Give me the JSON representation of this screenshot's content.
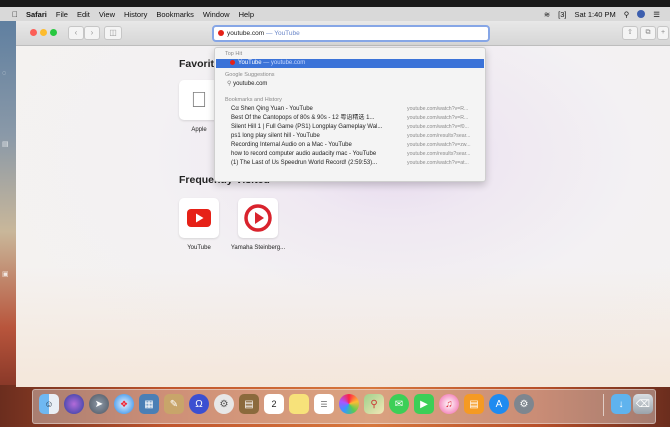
{
  "menubar": {
    "app": "Safari",
    "items": [
      "File",
      "Edit",
      "View",
      "History",
      "Bookmarks",
      "Window",
      "Help"
    ],
    "battery": "[3]",
    "clock": "Sat 1:40 PM"
  },
  "address_bar": {
    "text": "youtube.com",
    "hint": " — YouTube"
  },
  "dropdown": {
    "top_hit_header": "Top Hit",
    "top_hit": {
      "title": "YouTube",
      "url": " — youtube.com"
    },
    "google_header": "Google Suggestions",
    "google_suggestion": "youtube.com",
    "bookmarks_header": "Bookmarks and History",
    "bookmarks": [
      {
        "title": "Cα Shen Qing Yuan - YouTube",
        "url": "youtube.com/watch?v=R..."
      },
      {
        "title": "Best Of the Cantopops of 80s & 90s - 12 粤语精选 1...",
        "url": "youtube.com/watch?v=R..."
      },
      {
        "title": "Silent Hill 1 | Full Game (PS1) Longplay Gameplay Wal...",
        "url": "youtube.com/watch?v=f0..."
      },
      {
        "title": "ps1 long play silent hill - YouTube",
        "url": "youtube.com/results?sear..."
      },
      {
        "title": "Recording Internal Audio on a Mac - YouTube",
        "url": "youtube.com/watch?v=zw..."
      },
      {
        "title": "how to record computer audio audacity mac - YouTube",
        "url": "youtube.com/results?sear..."
      },
      {
        "title": "(1) The Last of Us Speedrun World Record! (2:59:53)...",
        "url": "youtube.com/watch?v=at..."
      }
    ]
  },
  "favorites": {
    "title": "Favorite",
    "items": [
      {
        "label": "Apple",
        "icon": "apple-icon"
      }
    ]
  },
  "frequently_visited": {
    "title": "Frequently Visited",
    "items": [
      {
        "label": "YouTube",
        "icon": "youtube-icon"
      },
      {
        "label": "Yamaha Steinberg...",
        "icon": "steinberg-icon"
      }
    ]
  },
  "dock": {
    "items": [
      "finder-icon",
      "siri-icon",
      "launchpad-icon",
      "safari-icon",
      "photo-viewer-icon",
      "scripting-icon",
      "headphones-icon",
      "settings-app-icon",
      "notes-icon",
      "calendar-icon",
      "stickies-icon",
      "reminders-icon",
      "photos-icon",
      "maps-icon",
      "messages-icon",
      "facetime-icon",
      "itunes-icon",
      "ibooks-icon",
      "app-store-icon",
      "system-preferences-icon",
      "downloads-folder-icon",
      "trash-icon"
    ],
    "calendar_day": "2"
  },
  "colors": {
    "youtube_red": "#e62117",
    "selection_blue": "#3b73d8",
    "address_focus": "#86a6e6"
  }
}
